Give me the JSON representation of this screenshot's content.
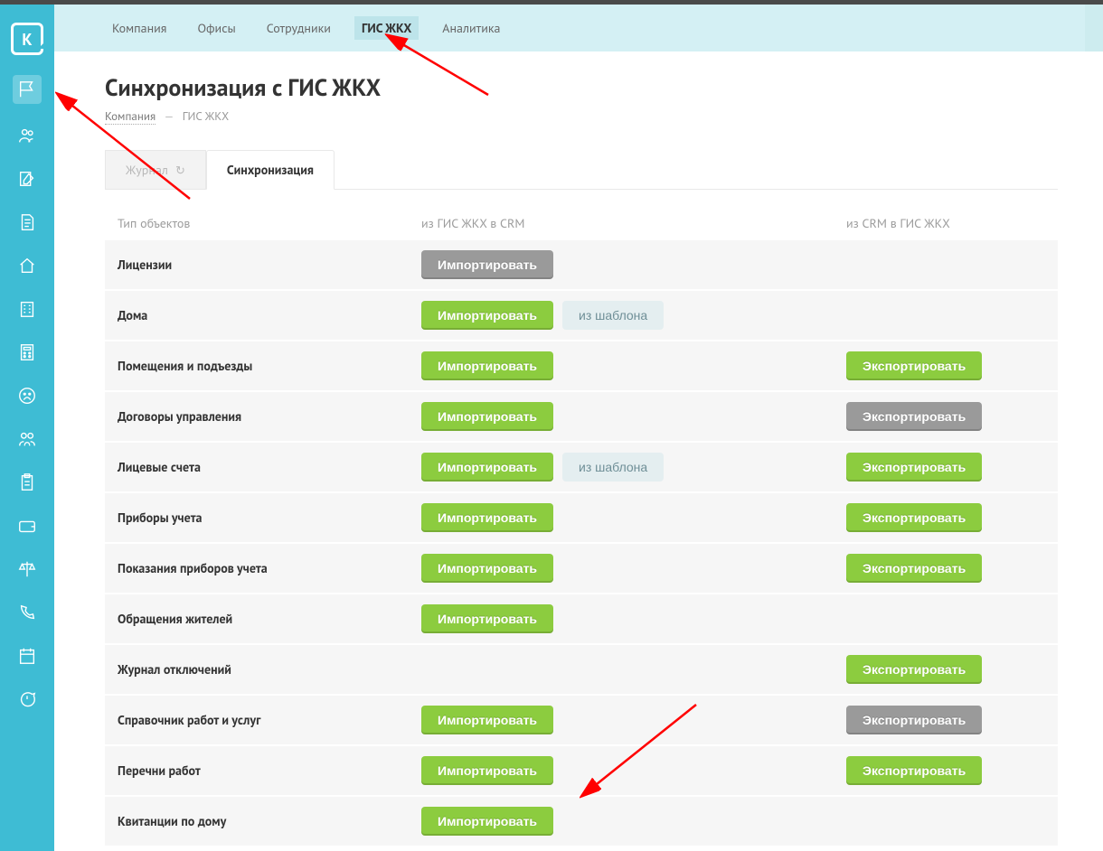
{
  "topnav": {
    "items": [
      "Компания",
      "Офисы",
      "Сотрудники",
      "ГИС ЖКХ",
      "Аналитика"
    ],
    "active": "ГИС ЖКХ"
  },
  "page": {
    "title": "Синхронизация с ГИС ЖКХ",
    "breadcrumb_link": "Компания",
    "breadcrumb_current": "ГИС ЖКХ",
    "breadcrumb_sep": "—"
  },
  "tabs": {
    "journal": "Журнал",
    "reload_glyph": "↻",
    "sync": "Синхронизация",
    "active": "sync"
  },
  "table": {
    "head_type": "Тип объектов",
    "head_import": "из ГИС ЖКХ в CRM",
    "head_export": "из CRM в ГИС ЖКХ",
    "import_label": "Импортировать",
    "export_label": "Экспортировать",
    "template_label": "из шаблона",
    "rows": [
      {
        "name": "Лицензии",
        "import": "disabled",
        "template": false,
        "export": null
      },
      {
        "name": "Дома",
        "import": "green",
        "template": true,
        "export": null
      },
      {
        "name": "Помещения и подъезды",
        "import": "green",
        "template": false,
        "export": "green"
      },
      {
        "name": "Договоры управления",
        "import": "green",
        "template": false,
        "export": "gray"
      },
      {
        "name": "Лицевые счета",
        "import": "green",
        "template": true,
        "export": "green"
      },
      {
        "name": "Приборы учета",
        "import": "green",
        "template": false,
        "export": "green"
      },
      {
        "name": "Показания приборов учета",
        "import": "green",
        "template": false,
        "export": "green"
      },
      {
        "name": "Обращения жителей",
        "import": "green",
        "template": false,
        "export": null
      },
      {
        "name": "Журнал отключений",
        "import": null,
        "template": false,
        "export": "green"
      },
      {
        "name": "Справочник работ и услуг",
        "import": "green",
        "template": false,
        "export": "gray"
      },
      {
        "name": "Перечни работ",
        "import": "green",
        "template": false,
        "export": "green"
      },
      {
        "name": "Квитанции по дому",
        "import": "green",
        "template": false,
        "export": null
      }
    ]
  },
  "sidebar_icons": [
    "flag-icon",
    "group-icon",
    "edit-icon",
    "document-icon",
    "home-icon",
    "building-icon",
    "calculator-icon",
    "sad-face-icon",
    "team-icon",
    "clipboard-icon",
    "wallet-icon",
    "scales-icon",
    "phone-icon",
    "calendar-icon",
    "chat-icon"
  ]
}
